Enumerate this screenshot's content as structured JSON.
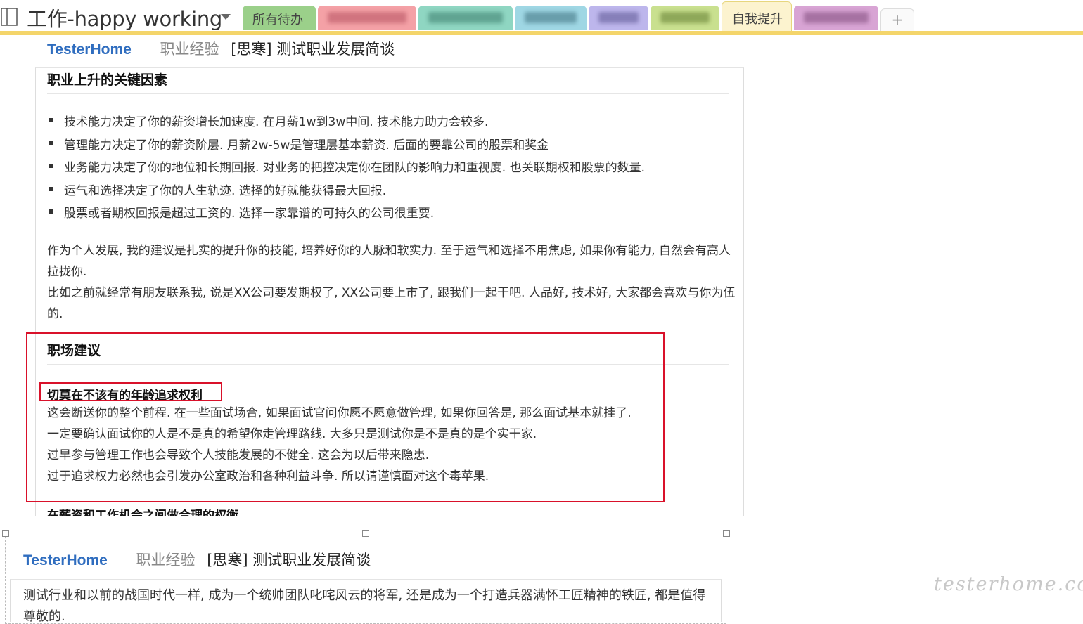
{
  "notebook": {
    "title": "工作-happy working"
  },
  "tabs": [
    {
      "label": "所有待办",
      "color": "#9bd08a",
      "blurred": false
    },
    {
      "label": "",
      "color": "#f4a1a6",
      "blurred": true
    },
    {
      "label": "",
      "color": "#8fd6c2",
      "blurred": true
    },
    {
      "label": "",
      "color": "#9fd7e4",
      "blurred": true
    },
    {
      "label": "",
      "color": "#bdb6ec",
      "blurred": true
    },
    {
      "label": "",
      "color": "#c9e08f",
      "blurred": true
    },
    {
      "label": "自我提升",
      "color": "#fcf3cf",
      "blurred": false,
      "active": true
    },
    {
      "label": "",
      "color": "#d8a4d4",
      "blurred": true
    }
  ],
  "tab_add_label": "+",
  "note": {
    "site": "TesterHome",
    "category": "职业经验",
    "title": "[思寒] 测试职业发展简谈",
    "section1": {
      "heading": "职业上升的关键因素",
      "bullets": [
        "技术能力决定了你的薪资增长加速度. 在月薪1w到3w中间. 技术能力助力会较多.",
        "管理能力决定了你的薪资阶层. 月薪2w-5w是管理层基本薪资. 后面的要靠公司的股票和奖金",
        "业务能力决定了你的地位和长期回报. 对业务的把控决定你在团队的影响力和重视度. 也关联期权和股票的数量.",
        "运气和选择决定了你的人生轨迹. 选择的好就能获得最大回报.",
        "股票或者期权回报是超过工资的. 选择一家靠谱的可持久的公司很重要."
      ],
      "para1": "作为个人发展, 我的建议是扎实的提升你的技能, 培养好你的人脉和软实力. 至于运气和选择不用焦虑, 如果你有能力, 自然会有高人拉拢你.",
      "para2": "比如之前就经常有朋友联系我, 说是XX公司要发期权了, XX公司要上市了, 跟我们一起干吧. 人品好, 技术好, 大家都会喜欢与你为伍的."
    },
    "section2": {
      "heading": "职场建议",
      "subheading": "切莫在不该有的年龄追求权利",
      "lines": [
        "这会断送你的整个前程. 在一些面试场合, 如果面试官问你愿不愿意做管理, 如果你回答是, 那么面试基本就挂了.",
        "一定要确认面试你的人是不是真的希望你走管理路线. 大多只是测试你是不是真的是个实干家.",
        "过早参与管理工作也会导致个人技能发展的不健全. 这会为以后带来隐患.",
        "过于追求权力必然也会引发办公室政治和各种利益斗争. 所以请谨慎面对这个毒苹果."
      ]
    },
    "next_heading": "在薪资和工作机会之间做合理的权衡"
  },
  "clip": {
    "site": "TesterHome",
    "category": "职业经验",
    "title": "[思寒] 测试职业发展简谈",
    "text": "测试行业和以前的战国时代一样, 成为一个统帅团队叱咤风云的将军, 还是成为一个打造兵器满怀工匠精神的铁匠, 都是值得尊敬的."
  },
  "watermark": "testerhome.com",
  "colors": {
    "accent_link": "#2f6dbf",
    "highlight_box": "#d9112a",
    "section_bar": "#f4d56a"
  }
}
